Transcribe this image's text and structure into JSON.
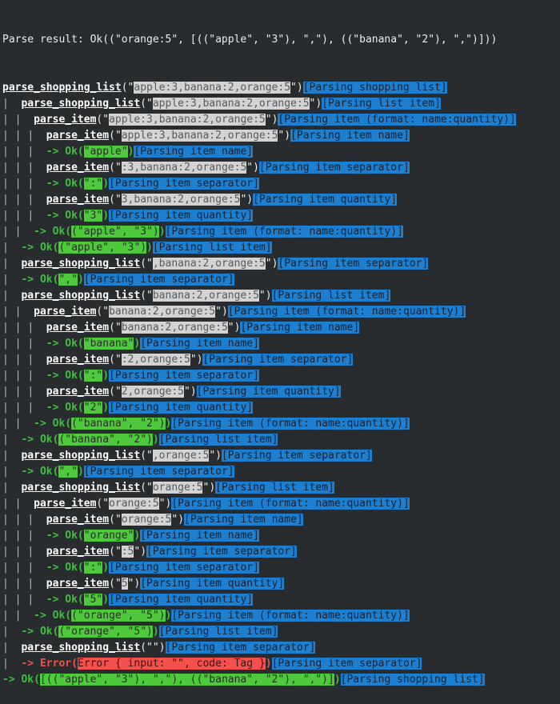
{
  "terminal": {
    "background_color": "#282c2e",
    "colors": {
      "text": "#ececec",
      "guide": "#b9b9b9",
      "input_highlight_bg": "#d3d3d3",
      "input_highlight_fg": "#555b5e",
      "ok_text": "#3fbf3f",
      "ok_highlight_bg": "#4ec93b",
      "error_text": "#f0514f",
      "error_highlight_bg": "#f4504e",
      "tag_highlight_bg": "#1d7fd0",
      "tag_highlight_fg": "#0e2238"
    },
    "header": "Parse result: Ok((\"orange:5\", [((\"apple\", \"3\"), \",\"), ((\"banana\", \"2\"), \",\")]))",
    "lines": [
      {
        "depth": 0,
        "kind": "call",
        "fn": "parse_shopping_list",
        "input": "apple:3,banana:2,orange:5",
        "tag": "[Parsing shopping list]"
      },
      {
        "depth": 1,
        "kind": "call",
        "fn": "parse_shopping_list",
        "input": "apple:3,banana:2,orange:5",
        "tag": "[Parsing list item]"
      },
      {
        "depth": 2,
        "kind": "call",
        "fn": "parse_item",
        "input": "apple:3,banana:2,orange:5",
        "tag": "[Parsing item (format: name:quantity)]"
      },
      {
        "depth": 3,
        "kind": "call",
        "fn": "parse_item",
        "input": "apple:3,banana:2,orange:5",
        "tag": "[Parsing item name]"
      },
      {
        "depth": 3,
        "kind": "ok",
        "value": "\"apple\"",
        "tag": "[Parsing item name]"
      },
      {
        "depth": 3,
        "kind": "call",
        "fn": "parse_item",
        "input": ":3,banana:2,orange:5",
        "tag": "[Parsing item separator]"
      },
      {
        "depth": 3,
        "kind": "ok",
        "value": "\":\"",
        "tag": "[Parsing item separator]"
      },
      {
        "depth": 3,
        "kind": "call",
        "fn": "parse_item",
        "input": "3,banana:2,orange:5",
        "tag": "[Parsing item quantity]"
      },
      {
        "depth": 3,
        "kind": "ok",
        "value": "\"3\"",
        "tag": "[Parsing item quantity]"
      },
      {
        "depth": 2,
        "kind": "ok",
        "value": "(\"apple\", \"3\")",
        "tag": "[Parsing item (format: name:quantity)]"
      },
      {
        "depth": 1,
        "kind": "ok",
        "value": "(\"apple\", \"3\")",
        "tag": "[Parsing list item]"
      },
      {
        "depth": 1,
        "kind": "call",
        "fn": "parse_shopping_list",
        "input": ",banana:2,orange:5",
        "tag": "[Parsing item separator]"
      },
      {
        "depth": 1,
        "kind": "ok",
        "value": "\",\"",
        "tag": "[Parsing item separator]"
      },
      {
        "depth": 1,
        "kind": "call",
        "fn": "parse_shopping_list",
        "input": "banana:2,orange:5",
        "tag": "[Parsing list item]"
      },
      {
        "depth": 2,
        "kind": "call",
        "fn": "parse_item",
        "input": "banana:2,orange:5",
        "tag": "[Parsing item (format: name:quantity)]"
      },
      {
        "depth": 3,
        "kind": "call",
        "fn": "parse_item",
        "input": "banana:2,orange:5",
        "tag": "[Parsing item name]"
      },
      {
        "depth": 3,
        "kind": "ok",
        "value": "\"banana\"",
        "tag": "[Parsing item name]"
      },
      {
        "depth": 3,
        "kind": "call",
        "fn": "parse_item",
        "input": ":2,orange:5",
        "tag": "[Parsing item separator]"
      },
      {
        "depth": 3,
        "kind": "ok",
        "value": "\":\"",
        "tag": "[Parsing item separator]"
      },
      {
        "depth": 3,
        "kind": "call",
        "fn": "parse_item",
        "input": "2,orange:5",
        "tag": "[Parsing item quantity]"
      },
      {
        "depth": 3,
        "kind": "ok",
        "value": "\"2\"",
        "tag": "[Parsing item quantity]"
      },
      {
        "depth": 2,
        "kind": "ok",
        "value": "(\"banana\", \"2\")",
        "tag": "[Parsing item (format: name:quantity)]"
      },
      {
        "depth": 1,
        "kind": "ok",
        "value": "(\"banana\", \"2\")",
        "tag": "[Parsing list item]"
      },
      {
        "depth": 1,
        "kind": "call",
        "fn": "parse_shopping_list",
        "input": ",orange:5",
        "tag": "[Parsing item separator]"
      },
      {
        "depth": 1,
        "kind": "ok",
        "value": "\",\"",
        "tag": "[Parsing item separator]"
      },
      {
        "depth": 1,
        "kind": "call",
        "fn": "parse_shopping_list",
        "input": "orange:5",
        "tag": "[Parsing list item]"
      },
      {
        "depth": 2,
        "kind": "call",
        "fn": "parse_item",
        "input": "orange:5",
        "tag": "[Parsing item (format: name:quantity)]"
      },
      {
        "depth": 3,
        "kind": "call",
        "fn": "parse_item",
        "input": "orange:5",
        "tag": "[Parsing item name]"
      },
      {
        "depth": 3,
        "kind": "ok",
        "value": "\"orange\"",
        "tag": "[Parsing item name]"
      },
      {
        "depth": 3,
        "kind": "call",
        "fn": "parse_item",
        "input": ":5",
        "tag": "[Parsing item separator]"
      },
      {
        "depth": 3,
        "kind": "ok",
        "value": "\":\"",
        "tag": "[Parsing item separator]"
      },
      {
        "depth": 3,
        "kind": "call",
        "fn": "parse_item",
        "input": "5",
        "tag": "[Parsing item quantity]"
      },
      {
        "depth": 3,
        "kind": "ok",
        "value": "\"5\"",
        "tag": "[Parsing item quantity]"
      },
      {
        "depth": 2,
        "kind": "ok",
        "value": "(\"orange\", \"5\")",
        "tag": "[Parsing item (format: name:quantity)]"
      },
      {
        "depth": 1,
        "kind": "ok",
        "value": "(\"orange\", \"5\")",
        "tag": "[Parsing list item]"
      },
      {
        "depth": 1,
        "kind": "call",
        "fn": "parse_shopping_list",
        "input": "",
        "tag": "[Parsing item separator]"
      },
      {
        "depth": 1,
        "kind": "error",
        "value": "Error { input: \"\", code: Tag }",
        "tag": "[Parsing item separator]"
      },
      {
        "depth": 0,
        "kind": "ok",
        "value": "[((\"apple\", \"3\"), \",\"), ((\"banana\", \"2\"), \",\")]",
        "tag": "[Parsing shopping list]"
      }
    ],
    "labels": {
      "ok_prefix": "-> Ok(",
      "error_prefix": "-> Error(",
      "close_paren": ")",
      "open_paren": "(",
      "quote": "\"",
      "guide_char": "|"
    }
  }
}
